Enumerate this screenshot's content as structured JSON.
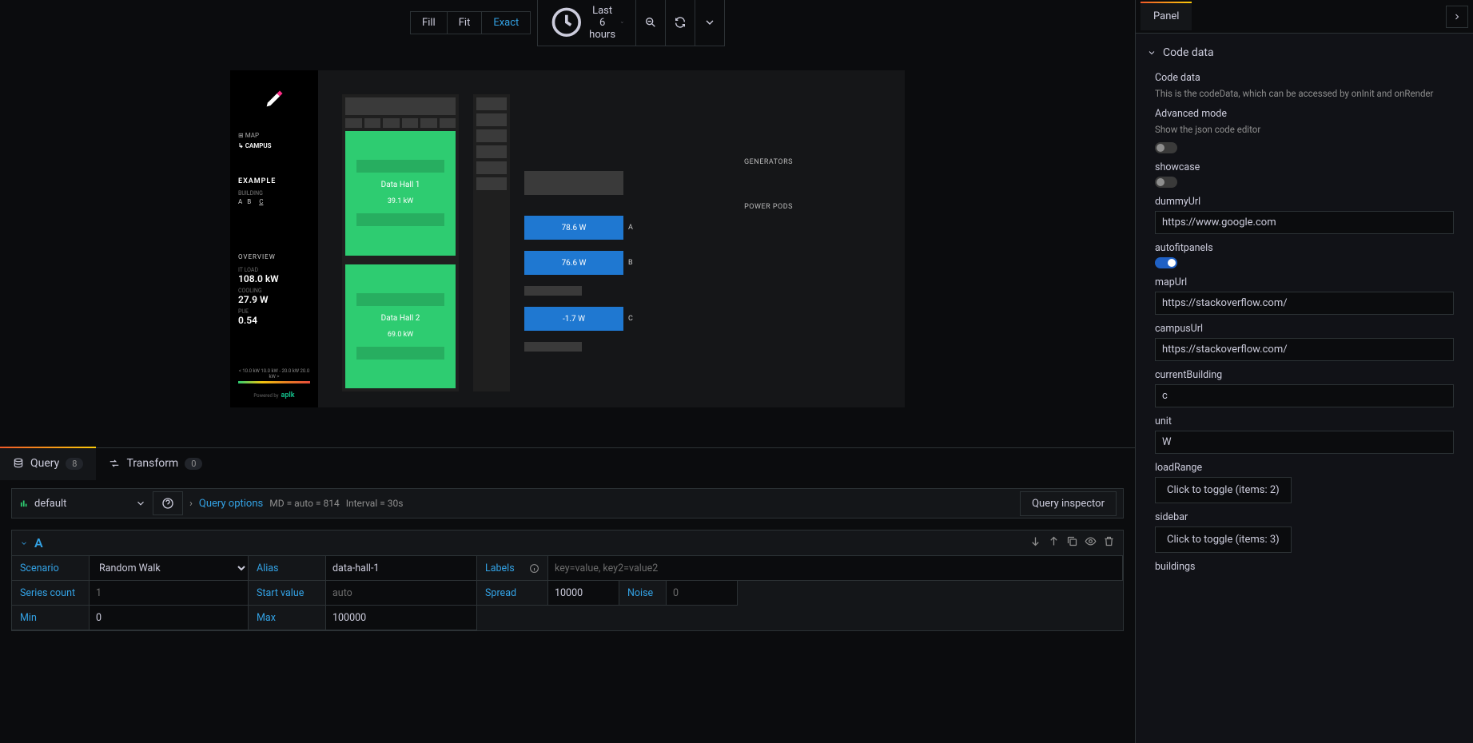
{
  "toolbar": {
    "fill": "Fill",
    "fit": "Fit",
    "exact": "Exact",
    "time_label": "Last 6 hours"
  },
  "vis_panel": {
    "nav_map": "MAP",
    "nav_campus": "CAMPUS",
    "example_label": "EXAMPLE",
    "building_label": "BUILDING",
    "buildings": [
      "A",
      "B",
      "C"
    ],
    "current_building": "C",
    "overview_label": "OVERVIEW",
    "metrics": [
      {
        "label": "IT LOAD",
        "value": "108.0 kW"
      },
      {
        "label": "COOLING",
        "value": "27.9 W"
      },
      {
        "label": "PUE",
        "value": "0.54"
      }
    ],
    "scale_text": "< 10.0 kW 10.0 kW - 20.0 kW 20.0 kW >",
    "powered_by": "Powered by",
    "brand": "aplk",
    "data_halls": [
      {
        "name": "Data Hall 1",
        "value": "39.1 kW"
      },
      {
        "name": "Data Hall 2",
        "value": "69.0 kW"
      }
    ],
    "generators_label": "GENERATORS",
    "power_pods_label": "POWER PODS",
    "pods": [
      {
        "label": "A",
        "value": "78.6 W",
        "class": "blue"
      },
      {
        "label": "B",
        "value": "76.6 W",
        "class": "blue"
      },
      {
        "label": "",
        "value": "",
        "class": "grey"
      },
      {
        "label": "C",
        "value": "-1.7 W",
        "class": "blue"
      },
      {
        "label": "",
        "value": "",
        "class": "grey"
      }
    ]
  },
  "tabs": {
    "query_label": "Query",
    "query_count": "8",
    "transform_label": "Transform",
    "transform_count": "0"
  },
  "query": {
    "datasource": "default",
    "options_label": "Query options",
    "md": "MD = auto = 814",
    "interval": "Interval = 30s",
    "inspector": "Query inspector",
    "row_name": "A",
    "fields": {
      "scenario_label": "Scenario",
      "scenario_value": "Random Walk",
      "alias_label": "Alias",
      "alias_value": "data-hall-1",
      "labels_label": "Labels",
      "labels_placeholder": "key=value, key2=value2",
      "series_count_label": "Series count",
      "series_count_placeholder": "1",
      "start_value_label": "Start value",
      "start_value_placeholder": "auto",
      "spread_label": "Spread",
      "spread_value": "10000",
      "noise_label": "Noise",
      "noise_placeholder": "0",
      "min_label": "Min",
      "min_value": "0",
      "max_label": "Max",
      "max_value": "100000"
    }
  },
  "right_panel": {
    "panel_tab": "Panel",
    "code_data_title": "Code data",
    "code_data_label": "Code data",
    "code_data_desc": "This is the codeData, which can be accessed by onInit and onRender",
    "advanced_mode_label": "Advanced mode",
    "advanced_mode_desc": "Show the json code editor",
    "showcase_label": "showcase",
    "dummyUrl_label": "dummyUrl",
    "dummyUrl_value": "https://www.google.com",
    "autofitpanels_label": "autofitpanels",
    "mapUrl_label": "mapUrl",
    "mapUrl_value": "https://stackoverflow.com/",
    "campusUrl_label": "campusUrl",
    "campusUrl_value": "https://stackoverflow.com/",
    "currentBuilding_label": "currentBuilding",
    "currentBuilding_value": "c",
    "unit_label": "unit",
    "unit_value": "W",
    "loadRange_label": "loadRange",
    "loadRange_button": "Click to toggle (items: 2)",
    "sidebar_label": "sidebar",
    "sidebar_button": "Click to toggle (items: 3)",
    "buildings_label": "buildings"
  }
}
